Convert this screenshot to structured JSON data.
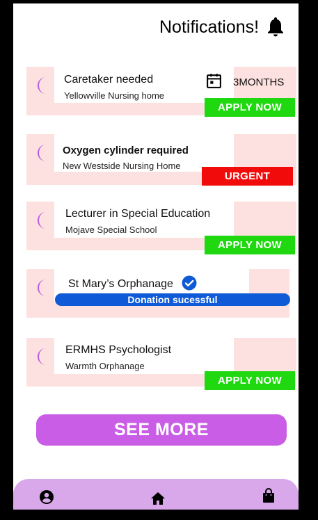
{
  "header": {
    "title": "Notifications!"
  },
  "cards": [
    {
      "title": "Caretaker needed",
      "subtitle": "Yellowville Nursing home",
      "duration": "3MONTHS",
      "badge": "APPLY NOW"
    },
    {
      "title": "Oxygen cylinder required",
      "subtitle": "New Westside Nursing Home",
      "badge": "URGENT"
    },
    {
      "title": "Lecturer in Special Education",
      "subtitle": "Mojave Special School",
      "badge": "APPLY NOW"
    },
    {
      "title": "St Mary’s Orphanage",
      "status": "Donation sucessful"
    },
    {
      "title": "ERMHS Psychologist",
      "subtitle": "Warmth Orphanage",
      "badge": "APPLY NOW"
    }
  ],
  "see_more_label": "SEE MORE",
  "nav": {
    "items": [
      "account-icon",
      "home-icon",
      "shopping-bag-icon"
    ]
  },
  "colors": {
    "card_bg": "#fde0e0",
    "apply": "#1fd80f",
    "urgent": "#f20b0b",
    "accent": "#c95de6",
    "moon": "#b45ae0",
    "nav": "#d9a8ea",
    "pill": "#0f5ad6"
  }
}
